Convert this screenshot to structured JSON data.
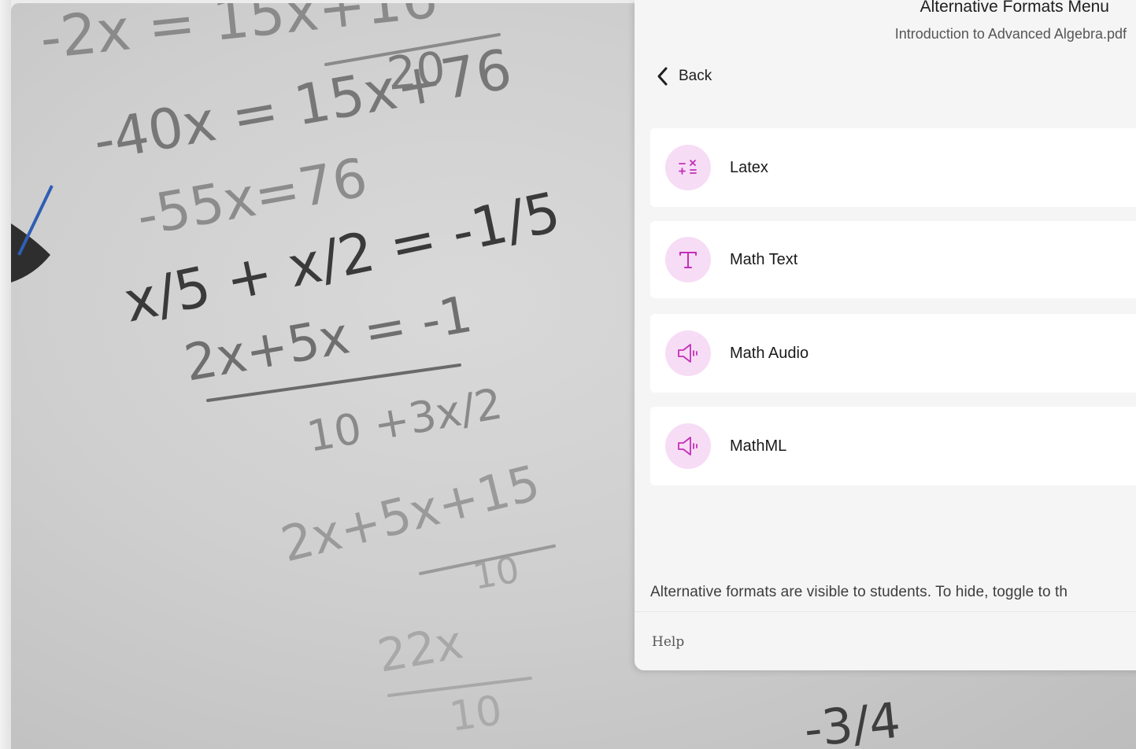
{
  "panel": {
    "title": "Alternative Formats Menu",
    "subtitle": "Introduction to Advanced Algebra.pdf",
    "back_label": "Back",
    "formats": [
      {
        "label": "Latex",
        "icon": "math-operators-icon"
      },
      {
        "label": "Math Text",
        "icon": "text-t-icon"
      },
      {
        "label": "Math Audio",
        "icon": "speaker-icon"
      },
      {
        "label": "MathML",
        "icon": "speaker-icon"
      }
    ],
    "footer_note": "Alternative formats are visible to students. To hide, toggle to th",
    "help_label": "Help"
  },
  "background": {
    "handwriting": [
      "-2x = 15x+16",
      "20",
      "-40x = 15x+76",
      "-55x=76",
      "x/5 + x/2 = -1/5",
      "2x+5x = -1",
      "10 +3x/2",
      "2x+5x+15",
      "10",
      "22x",
      "10",
      "-3/4"
    ]
  },
  "colors": {
    "accent": "#c230b8",
    "icon_bg": "#f7dcf5",
    "panel_bg": "#f5f5f5",
    "card_bg": "#ffffff"
  }
}
